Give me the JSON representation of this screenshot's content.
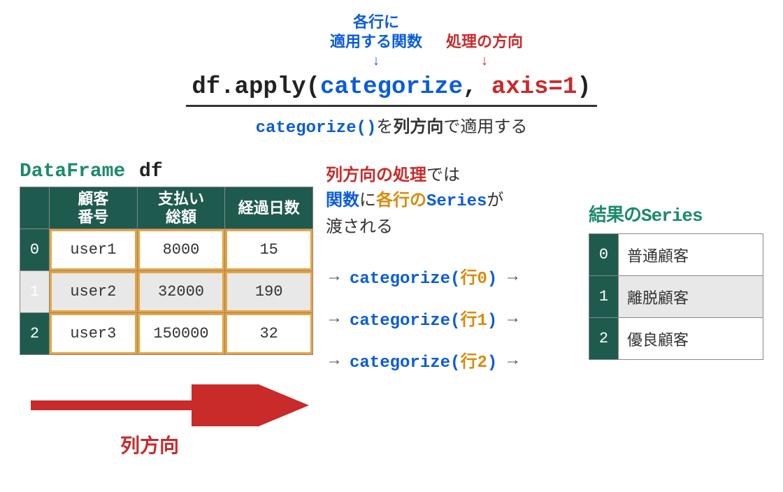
{
  "annotations": {
    "func_line1": "各行に",
    "func_line2": "適用する関数",
    "dir_label": "処理の方向",
    "arrow": "↓"
  },
  "code": {
    "p1": "df.apply(",
    "fn": "categorize",
    "comma": ", ",
    "ax": "axis=1",
    "p2": ")"
  },
  "subline": {
    "fn": "categorize()",
    "t1": "を",
    "em": "列方向",
    "t2": "で適用する"
  },
  "df_title": {
    "t1": "DataFrame",
    "t2": "df"
  },
  "df": {
    "cols": [
      "顧客\n番号",
      "支払い\n総額",
      "経過日数"
    ],
    "rows": [
      {
        "idx": "0",
        "cells": [
          "user1",
          "8000",
          "15"
        ]
      },
      {
        "idx": "1",
        "cells": [
          "user2",
          "32000",
          "190"
        ]
      },
      {
        "idx": "2",
        "cells": [
          "user3",
          "150000",
          "32"
        ]
      }
    ]
  },
  "mid": {
    "l1a": "列方向の処理",
    "l1b": "では",
    "l2a": "関数",
    "l2b": "に",
    "l2c": "各行の",
    "l2d": "Series",
    "l2e": "が",
    "l3": "渡される"
  },
  "calls": [
    {
      "arrow": "→",
      "name": "categorize",
      "open": "(",
      "arg_pre": "行",
      "arg_i": "0",
      "close": ")",
      "arrow2": "→"
    },
    {
      "arrow": "→",
      "name": "categorize",
      "open": "(",
      "arg_pre": "行",
      "arg_i": "1",
      "close": ")",
      "arrow2": "→"
    },
    {
      "arrow": "→",
      "name": "categorize",
      "open": "(",
      "arg_pre": "行",
      "arg_i": "2",
      "close": ")",
      "arrow2": "→"
    }
  ],
  "result": {
    "title_a": "結果の",
    "title_b": "Series",
    "rows": [
      {
        "idx": "0",
        "val": "普通顧客"
      },
      {
        "idx": "1",
        "val": "離脱顧客"
      },
      {
        "idx": "2",
        "val": "優良顧客"
      }
    ]
  },
  "direction_label": "列方向"
}
